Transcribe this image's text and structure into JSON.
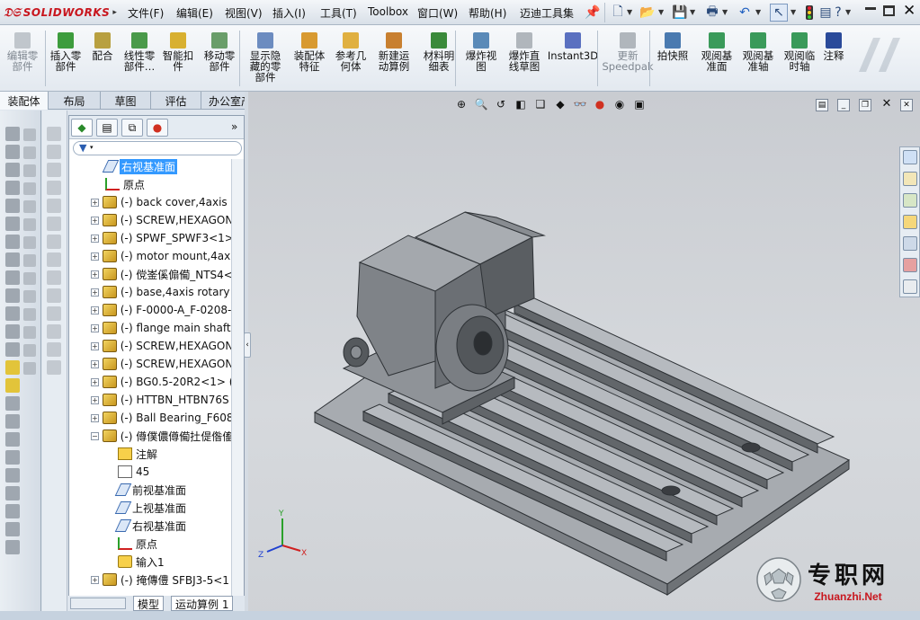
{
  "app": {
    "logo": "SOLIDWORKS"
  },
  "menu": [
    "文件(F)",
    "编辑(E)",
    "视图(V)",
    "插入(I)",
    "工具(T)",
    "Toolbox",
    "窗口(W)",
    "帮助(H)",
    "迈迪工具集"
  ],
  "commands": [
    {
      "label": "编辑零\n部件",
      "icon": "edit-component-icon",
      "dim": true
    },
    {
      "label": "插入零\n部件",
      "icon": "insert-component-icon",
      "dim": false
    },
    {
      "label": "配合",
      "icon": "mate-icon",
      "dim": false
    },
    {
      "label": "线性零\n部件…",
      "icon": "linear-pattern-icon",
      "dim": false
    },
    {
      "label": "智能扣\n件",
      "icon": "smart-fasteners-icon",
      "dim": false
    },
    {
      "label": "移动零\n部件",
      "icon": "move-component-icon",
      "dim": false
    },
    {
      "label": "显示隐\n藏的零\n部件",
      "icon": "show-hidden-icon",
      "dim": false
    },
    {
      "label": "装配体\n特征",
      "icon": "assembly-feature-icon",
      "dim": false
    },
    {
      "label": "参考几\n何体",
      "icon": "reference-geometry-icon",
      "dim": false
    },
    {
      "label": "新建运\n动算例",
      "icon": "new-motion-study-icon",
      "dim": false
    },
    {
      "label": "材料明\n细表",
      "icon": "bom-icon",
      "dim": false
    },
    {
      "label": "爆炸视\n图",
      "icon": "exploded-view-icon",
      "dim": false
    },
    {
      "label": "爆炸直\n线草图",
      "icon": "explode-line-sketch-icon",
      "dim": false
    },
    {
      "label": "Instant3D",
      "icon": "instant3d-icon",
      "dim": false
    },
    {
      "label": "更新\nSpeedpak",
      "icon": "speedpak-icon",
      "dim": true
    },
    {
      "label": "拍快照",
      "icon": "snapshot-icon",
      "dim": false
    },
    {
      "label": "观阅基\n准面",
      "icon": "view-planes-icon",
      "dim": false
    },
    {
      "label": "观阅基\n准轴",
      "icon": "view-axes-icon",
      "dim": false
    },
    {
      "label": "观阅临\n时轴",
      "icon": "view-temp-axes-icon",
      "dim": false
    },
    {
      "label": "注释",
      "icon": "annotation-icon",
      "dim": false
    }
  ],
  "tabs": [
    "装配体",
    "布局",
    "草图",
    "评估",
    "办公室产品"
  ],
  "active_tab": "装配体",
  "tree": [
    {
      "label": "右视基准面",
      "icon": "plane-icon",
      "indent": 1,
      "expand": false,
      "selected": true
    },
    {
      "label": "原点",
      "icon": "origin-icon",
      "indent": 1,
      "expand": false
    },
    {
      "label": "(-) back cover,4axis",
      "icon": "part-icon",
      "indent": 0,
      "expand": true
    },
    {
      "label": "(-) SCREW,HEXAGON",
      "icon": "part-icon",
      "indent": 0,
      "expand": true
    },
    {
      "label": "(-) SPWF_SPWF3<1>",
      "icon": "part-icon",
      "indent": 0,
      "expand": true
    },
    {
      "label": "(-) motor mount,4ax",
      "icon": "part-icon",
      "indent": 0,
      "expand": true
    },
    {
      "label": "(-) 傥崟傒傓僃_NTS4<",
      "icon": "part-icon",
      "indent": 0,
      "expand": true
    },
    {
      "label": "(-) base,4axis rotary",
      "icon": "part-icon",
      "indent": 0,
      "expand": true
    },
    {
      "label": "(-) F-0000-A_F-0208-",
      "icon": "part-icon",
      "indent": 0,
      "expand": true
    },
    {
      "label": "(-) flange main shaft",
      "icon": "part-icon",
      "indent": 0,
      "expand": true
    },
    {
      "label": "(-) SCREW,HEXAGON",
      "icon": "part-icon",
      "indent": 0,
      "expand": true
    },
    {
      "label": "(-) SCREW,HEXAGON",
      "icon": "part-icon",
      "indent": 0,
      "expand": true
    },
    {
      "label": "(-) BG0.5-20R2<1> (",
      "icon": "part-icon",
      "indent": 0,
      "expand": true
    },
    {
      "label": "(-) HTTBN_HTBN76S",
      "icon": "part-icon",
      "indent": 0,
      "expand": true
    },
    {
      "label": "(-) Ball Bearing_F608",
      "icon": "part-icon",
      "indent": 0,
      "expand": true
    },
    {
      "label": "(-) 僔僕儂僔僃扗偍偺傗",
      "icon": "part-icon",
      "indent": 0,
      "expand": "minus"
    },
    {
      "label": "注解",
      "icon": "annotation-folder-icon",
      "indent": 2,
      "expand": false
    },
    {
      "label": "45",
      "icon": "equation-icon",
      "indent": 2,
      "expand": false
    },
    {
      "label": "前视基准面",
      "icon": "plane-icon",
      "indent": 2,
      "expand": false
    },
    {
      "label": "上视基准面",
      "icon": "plane-icon",
      "indent": 2,
      "expand": false
    },
    {
      "label": "右视基准面",
      "icon": "plane-icon",
      "indent": 2,
      "expand": false
    },
    {
      "label": "原点",
      "icon": "origin-icon",
      "indent": 2,
      "expand": false
    },
    {
      "label": "输入1",
      "icon": "import-icon",
      "indent": 2,
      "expand": false
    },
    {
      "label": "(-) 掩傳僼 SFBJ3-5<1",
      "icon": "part-icon",
      "indent": 0,
      "expand": true
    }
  ],
  "bottom_tabs": [
    "模型",
    "运动算例 1"
  ],
  "watermark": {
    "cn": "专职网",
    "url": "Zhuanzhi.Net"
  },
  "triad": {
    "x": "X",
    "y": "Y",
    "z": "Z"
  },
  "colors": {
    "accent": "#3399ff",
    "brand": "#c8161e",
    "model": "#8e9297"
  }
}
